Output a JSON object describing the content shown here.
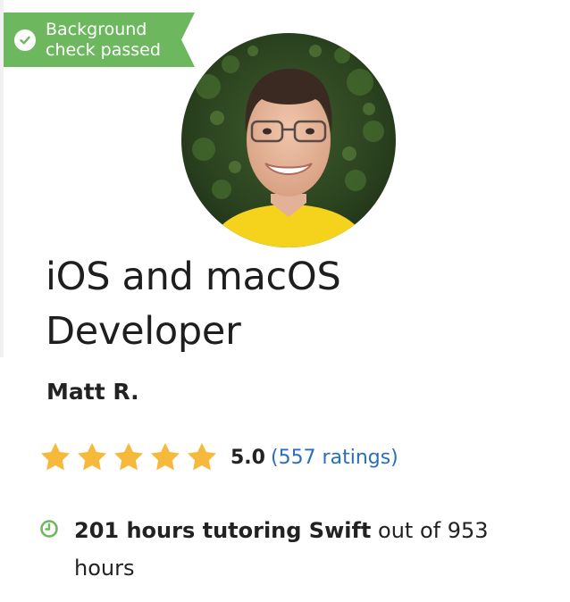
{
  "badge": {
    "icon": "check-circle-icon",
    "text": "Background check passed",
    "color": "#6db85f"
  },
  "profile": {
    "avatar_description_icon": "tutor-avatar",
    "title": "iOS and macOS Developer",
    "name": "Matt R."
  },
  "rating": {
    "stars": 5,
    "star_color": "#f5b93b",
    "score": "5.0",
    "ratings_link": "(557 ratings)",
    "link_color": "#2a6ebd"
  },
  "hours": {
    "icon": "clock-icon",
    "icon_color": "#6db85f",
    "bold_text": "201 hours tutoring Swift",
    "rest_text": " out of 953 hours"
  }
}
